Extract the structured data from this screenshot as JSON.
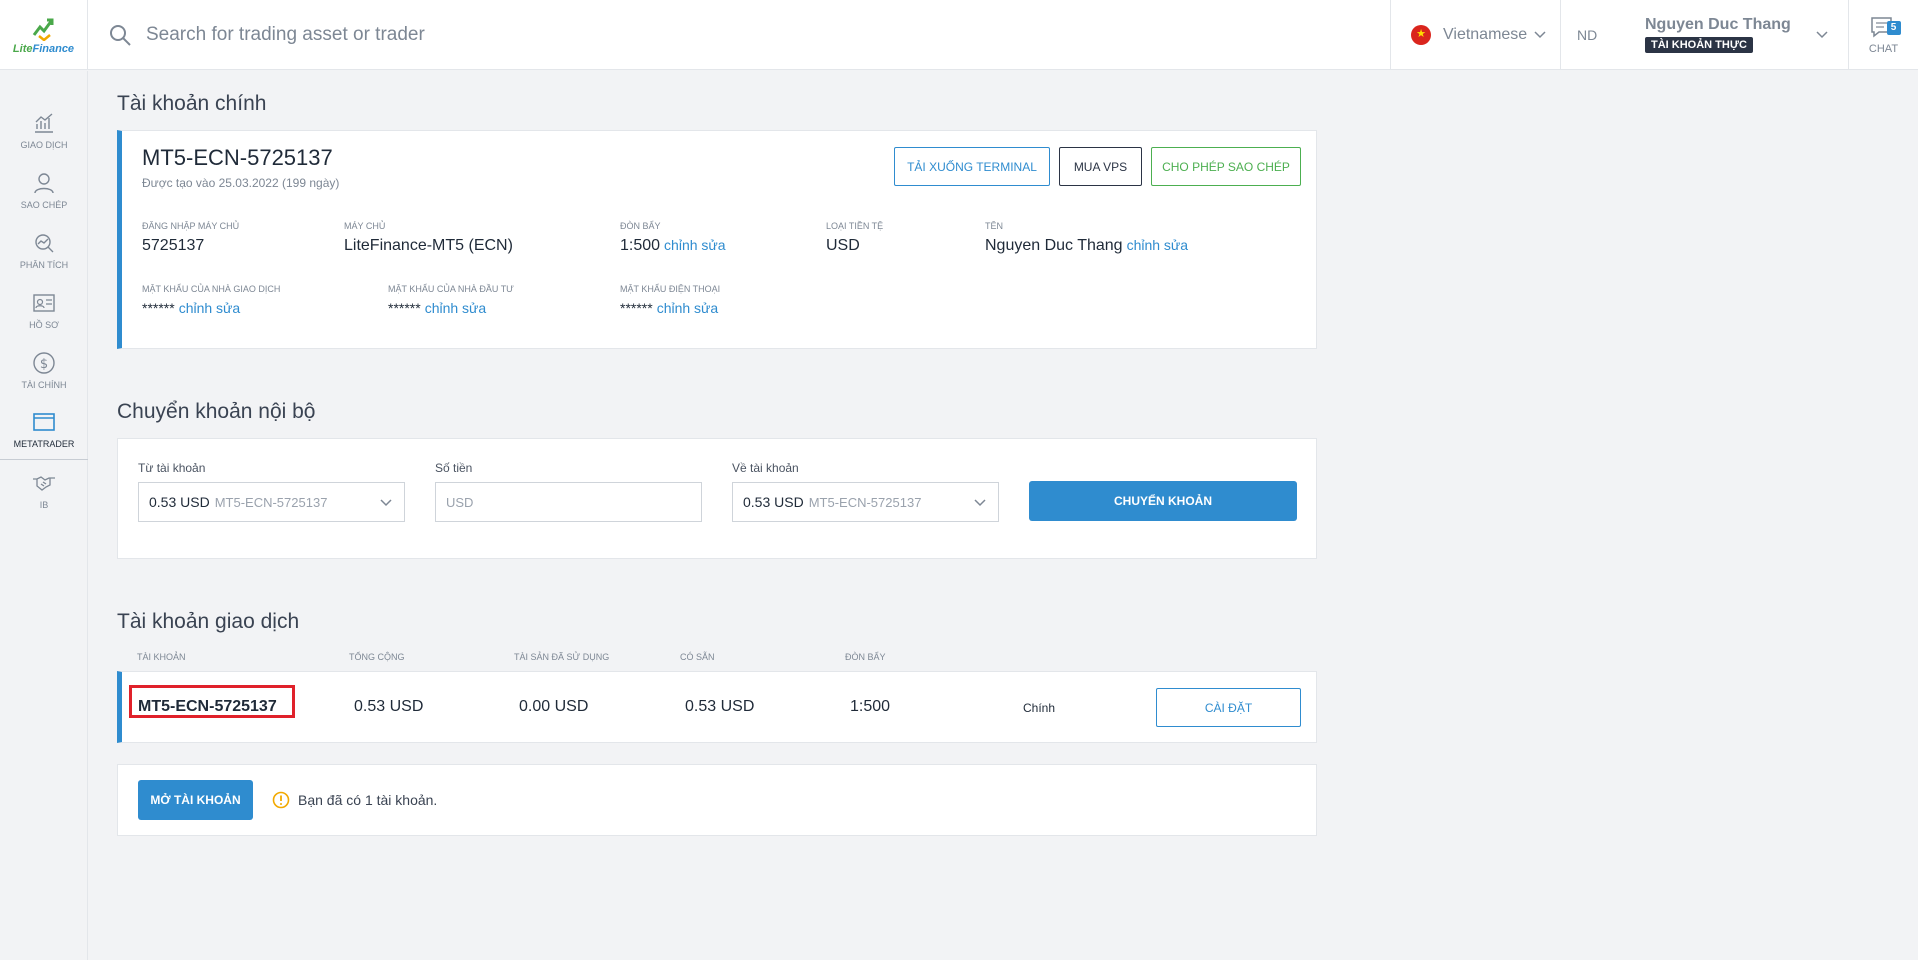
{
  "brand": {
    "logo_text_1": "Lite",
    "logo_text_2": "Finance"
  },
  "search": {
    "placeholder": "Search for trading asset or trader"
  },
  "language": {
    "label": "Vietnamese"
  },
  "user": {
    "initials": "ND",
    "name": "Nguyen Duc Thang",
    "badge": "TÀI KHOẢN THỰC"
  },
  "chat": {
    "label": "CHAT",
    "count": "5"
  },
  "sidebar": {
    "items": [
      {
        "label": "GIAO DỊCH",
        "icon": "chart-icon"
      },
      {
        "label": "SAO CHÉP",
        "icon": "user-copy-icon"
      },
      {
        "label": "PHÂN TÍCH",
        "icon": "analysis-icon"
      },
      {
        "label": "HỒ SƠ",
        "icon": "profile-card-icon"
      },
      {
        "label": "TÀI CHÍNH",
        "icon": "dollar-icon"
      },
      {
        "label": "METATRADER",
        "icon": "window-icon"
      },
      {
        "label": "IB",
        "icon": "handshake-icon"
      }
    ]
  },
  "main_account": {
    "section_title": "Tài khoản chính",
    "name": "MT5-ECN-5725137",
    "created": "Được tạo vào 25.03.2022 (199 ngày)",
    "buttons": {
      "download": "TẢI XUỐNG TERMINAL",
      "vps": "MUA VPS",
      "copy": "CHO PHÉP SAO CHÉP"
    },
    "fields": {
      "login_label": "ĐĂNG NHẬP MÁY CHỦ",
      "login_value": "5725137",
      "server_label": "MÁY CHỦ",
      "server_value": "LiteFinance-MT5 (ECN)",
      "leverage_label": "ĐÒN BẨY",
      "leverage_value": "1:500",
      "currency_label": "LOẠI TIỀN TỆ",
      "currency_value": "USD",
      "name_label": "TÊN",
      "name_value": "Nguyen Duc Thang",
      "trader_pw_label": "MẬT KHẨU CỦA NHÀ GIAO DỊCH",
      "trader_pw_value": "******",
      "investor_pw_label": "MẬT KHẨU CỦA NHÀ ĐẦU TƯ",
      "investor_pw_value": "******",
      "phone_pw_label": "MẬT KHẨU ĐIỆN THOẠI",
      "phone_pw_value": "******",
      "edit_link": "chỉnh sửa"
    }
  },
  "transfer": {
    "section_title": "Chuyển khoản nội bộ",
    "from_label": "Từ tài khoản",
    "from_amount": "0.53 USD",
    "from_account": "MT5-ECN-5725137",
    "amount_label": "Số tiền",
    "amount_placeholder": "USD",
    "to_label": "Về tài khoản",
    "to_amount": "0.53 USD",
    "to_account": "MT5-ECN-5725137",
    "submit": "CHUYỂN KHOẢN"
  },
  "trading_accounts": {
    "section_title": "Tài khoản giao dịch",
    "columns": [
      "TÀI KHOẢN",
      "TỔNG CỘNG",
      "TÀI SẢN ĐÃ SỬ DỤNG",
      "CÓ SẴN",
      "ĐÒN BẨY"
    ],
    "rows": [
      {
        "account": "MT5-ECN-5725137",
        "total": "0.53 USD",
        "used": "0.00 USD",
        "available": "0.53 USD",
        "leverage": "1:500",
        "type": "Chính",
        "action": "CÀI ĐẶT"
      }
    ],
    "open_button": "MỞ TÀI KHOẢN",
    "notice": "Bạn đã có 1 tài khoản."
  }
}
